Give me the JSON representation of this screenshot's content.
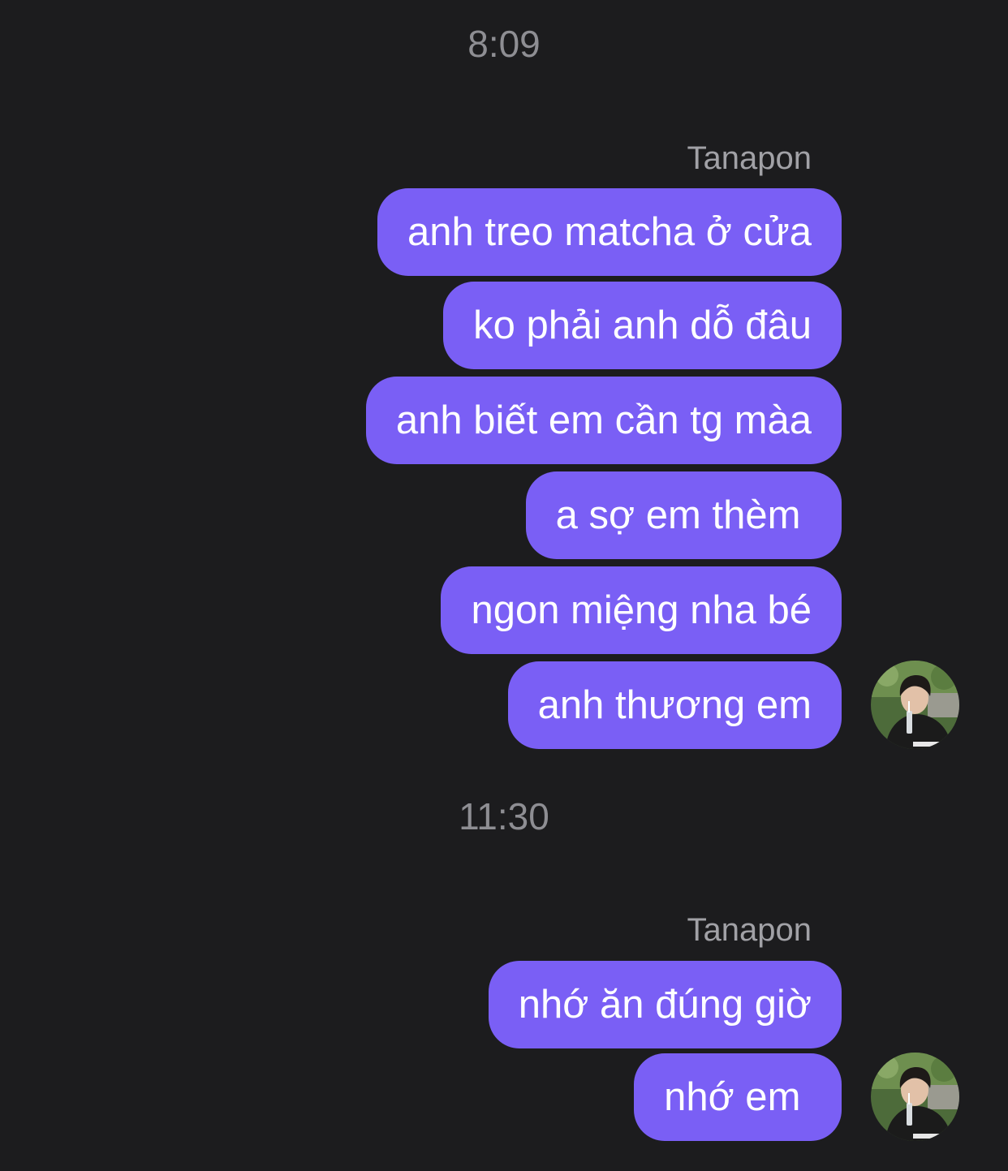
{
  "chat": {
    "groups": [
      {
        "time": "8:09",
        "sender": "Tanapon",
        "messages": [
          "anh treo matcha ở cửa",
          "ko phải anh dỗ đâu",
          "anh biết em cần tg màa",
          "a sợ em thèm ",
          "ngon miệng nha bé",
          "anh thương em"
        ]
      },
      {
        "time": "11:30",
        "sender": "Tanapon",
        "messages": [
          "nhớ ăn đúng giờ",
          "nhớ em "
        ]
      }
    ]
  },
  "colors": {
    "background": "#1c1c1e",
    "bubble": "#7a5ff5",
    "timestamp_text": "#8e8e93",
    "sender_text": "#a1a1a6"
  },
  "icons": {
    "avatar": "user-avatar-photo"
  }
}
